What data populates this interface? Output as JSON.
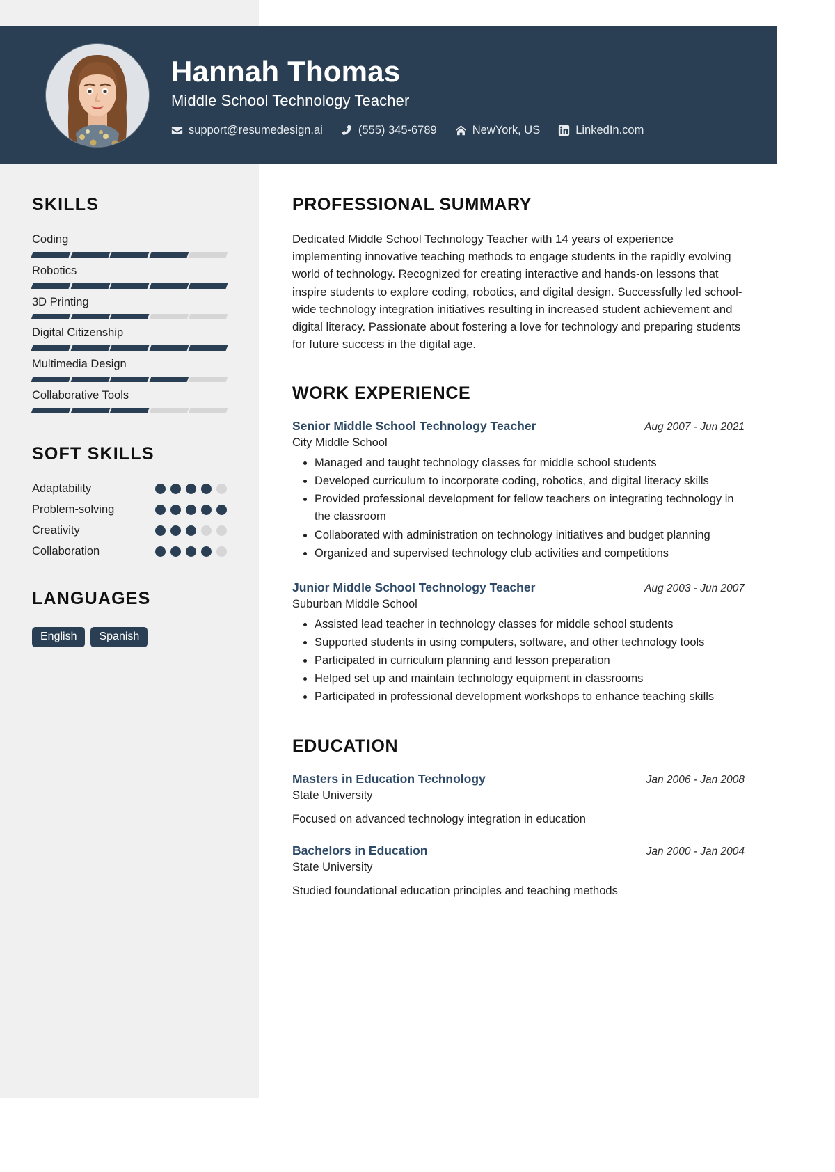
{
  "header": {
    "name": "Hannah Thomas",
    "job_title": "Middle School Technology Teacher",
    "accent_color": "#2a3f54",
    "contacts": [
      {
        "icon": "email-icon",
        "text": "support@resumedesign.ai"
      },
      {
        "icon": "phone-icon",
        "text": "(555) 345-6789"
      },
      {
        "icon": "home-icon",
        "text": "NewYork, US"
      },
      {
        "icon": "linkedin-icon",
        "text": "LinkedIn.com"
      }
    ]
  },
  "sidebar": {
    "skills_heading": "SKILLS",
    "skills": [
      {
        "name": "Coding",
        "level": 4,
        "max": 5
      },
      {
        "name": "Robotics",
        "level": 5,
        "max": 5
      },
      {
        "name": "3D Printing",
        "level": 3,
        "max": 5
      },
      {
        "name": "Digital Citizenship",
        "level": 5,
        "max": 5
      },
      {
        "name": "Multimedia Design",
        "level": 4,
        "max": 5
      },
      {
        "name": "Collaborative Tools",
        "level": 3,
        "max": 5
      }
    ],
    "soft_skills_heading": "SOFT SKILLS",
    "soft_skills": [
      {
        "name": "Adaptability",
        "level": 4,
        "max": 5
      },
      {
        "name": "Problem-solving",
        "level": 5,
        "max": 5
      },
      {
        "name": "Creativity",
        "level": 3,
        "max": 5
      },
      {
        "name": "Collaboration",
        "level": 4,
        "max": 5
      }
    ],
    "languages_heading": "LANGUAGES",
    "languages": [
      "English",
      "Spanish"
    ]
  },
  "main": {
    "summary_heading": "PROFESSIONAL SUMMARY",
    "summary": "Dedicated Middle School Technology Teacher with 14 years of experience implementing innovative teaching methods to engage students in the rapidly evolving world of technology. Recognized for creating interactive and hands-on lessons that inspire students to explore coding, robotics, and digital design. Successfully led school-wide technology integration initiatives resulting in increased student achievement and digital literacy. Passionate about fostering a love for technology and preparing students for future success in the digital age.",
    "work_heading": "WORK EXPERIENCE",
    "work": [
      {
        "title": "Senior Middle School Technology Teacher",
        "date": "Aug 2007 - Jun 2021",
        "org": "City Middle School",
        "bullets": [
          "Managed and taught technology classes for middle school students",
          "Developed curriculum to incorporate coding, robotics, and digital literacy skills",
          "Provided professional development for fellow teachers on integrating technology in the classroom",
          "Collaborated with administration on technology initiatives and budget planning",
          "Organized and supervised technology club activities and competitions"
        ]
      },
      {
        "title": "Junior Middle School Technology Teacher",
        "date": "Aug 2003 - Jun 2007",
        "org": "Suburban Middle School",
        "bullets": [
          "Assisted lead teacher in technology classes for middle school students",
          "Supported students in using computers, software, and other technology tools",
          "Participated in curriculum planning and lesson preparation",
          "Helped set up and maintain technology equipment in classrooms",
          "Participated in professional development workshops to enhance teaching skills"
        ]
      }
    ],
    "education_heading": "EDUCATION",
    "education": [
      {
        "degree": "Masters in Education Technology",
        "date": "Jan 2006 - Jan 2008",
        "school": "State University",
        "description": "Focused on advanced technology integration in education"
      },
      {
        "degree": "Bachelors in Education",
        "date": "Jan 2000 - Jan 2004",
        "school": "State University",
        "description": "Studied foundational education principles and teaching methods"
      }
    ]
  }
}
